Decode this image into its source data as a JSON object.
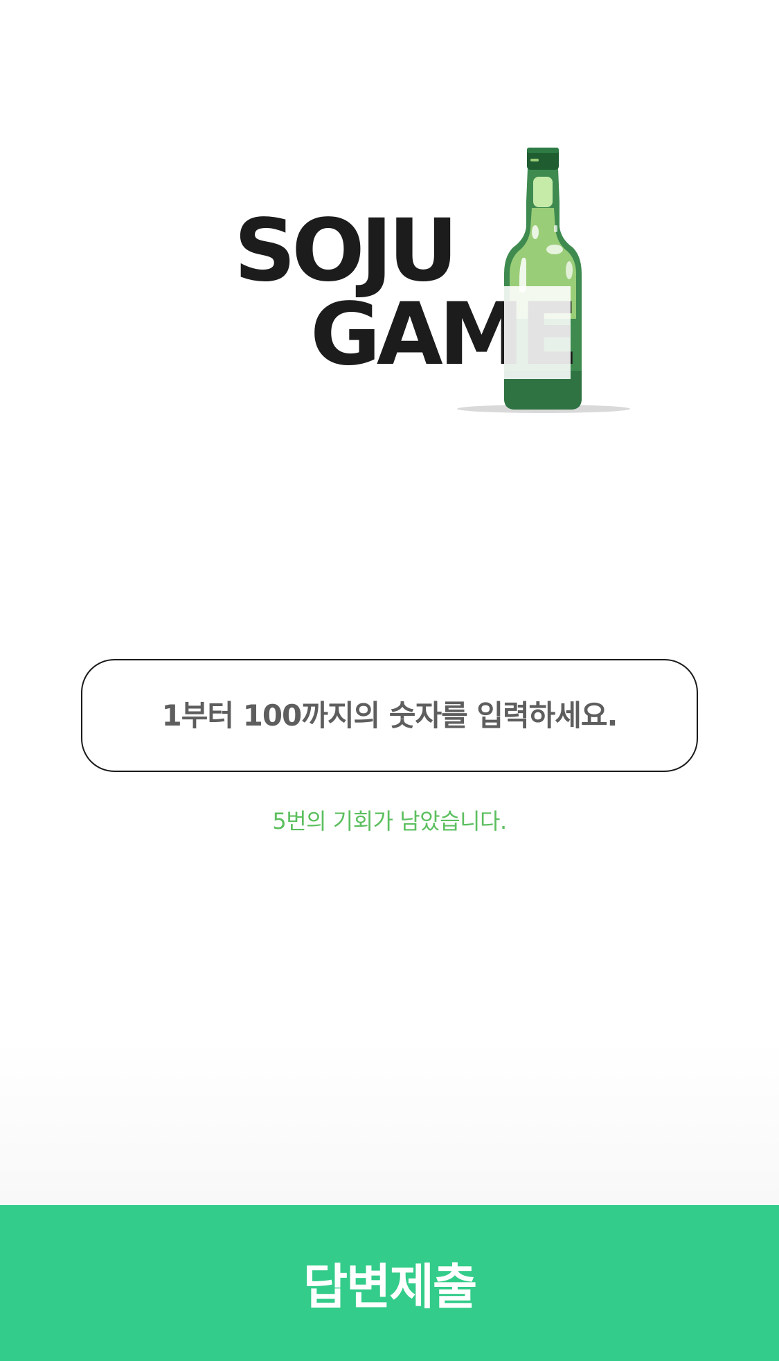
{
  "logo": {
    "line1": "SOJU",
    "line2": "GAME",
    "icon": "soju-bottle-icon"
  },
  "guess_input": {
    "placeholder": "1부터 100까지의 숫자를 입력하세요.",
    "value": ""
  },
  "status": {
    "chances_text": "5번의 기회가 남았습니다."
  },
  "submit": {
    "label": "답변제출"
  },
  "colors": {
    "submit_bg": "#33CC8A",
    "chances_text": "#5CBF5F",
    "placeholder_text": "#5E5E5E",
    "logo_text": "#1C1C1C",
    "bottle_green": "#3E8A4F",
    "bottle_light": "#9ACD78"
  }
}
